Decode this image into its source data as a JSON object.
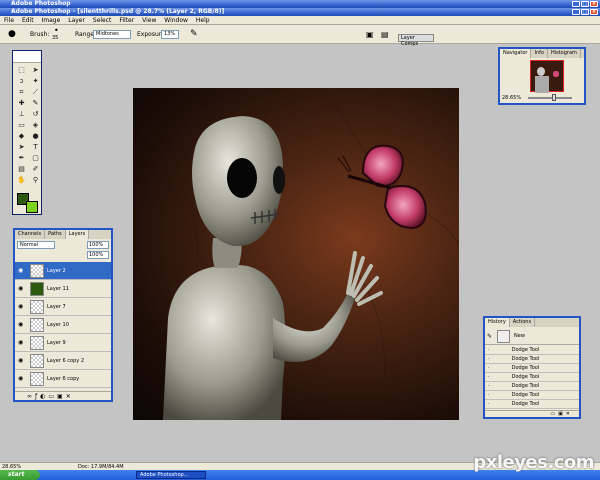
{
  "window": {
    "app_title": "Adobe Photoshop",
    "doc_title": "Adobe Photoshop - [silentthrills.psd @ 28.7% (Layer 2, RGB/8)]"
  },
  "menu": [
    "File",
    "Edit",
    "Image",
    "Layer",
    "Select",
    "Filter",
    "View",
    "Window",
    "Help"
  ],
  "options": {
    "brush_label": "Brush:",
    "brush_size": "35",
    "range_label": "Range:",
    "range_value": "Midtones",
    "exposure_label": "Exposure:",
    "exposure_value": "13%",
    "well_label": "Layer Comps"
  },
  "navigator": {
    "tabs": [
      "Navigator",
      "Info",
      "Histogram"
    ],
    "zoom": "28.65%"
  },
  "layers": {
    "tabs": [
      "Channels",
      "Paths",
      "Layers"
    ],
    "blend_mode": "Normal",
    "opacity": "100%",
    "fill": "100%",
    "rows": [
      {
        "name": "Layer 2",
        "selected": true
      },
      {
        "name": "Layer 11"
      },
      {
        "name": "Layer 7"
      },
      {
        "name": "Layer 10"
      },
      {
        "name": "Layer 9"
      },
      {
        "name": "Layer 6 copy 2"
      },
      {
        "name": "Layer 6 copy"
      }
    ]
  },
  "history": {
    "tabs": [
      "History",
      "Actions"
    ],
    "snapshot": "New",
    "steps": [
      "Dodge Tool",
      "Dodge Tool",
      "Dodge Tool",
      "Dodge Tool",
      "Dodge Tool",
      "Dodge Tool",
      "Dodge Tool"
    ]
  },
  "status": {
    "zoom": "28.65%",
    "doc": "Doc: 17.9M/84.4M"
  },
  "taskbar": {
    "start": "start",
    "item": "Adobe Photoshop..."
  },
  "watermark": "pxleyes.com",
  "colors": {
    "foreground": "#2d5a10",
    "background": "#7ed321",
    "titlebar": "#2e5cc9",
    "selection": "#316ac5"
  }
}
